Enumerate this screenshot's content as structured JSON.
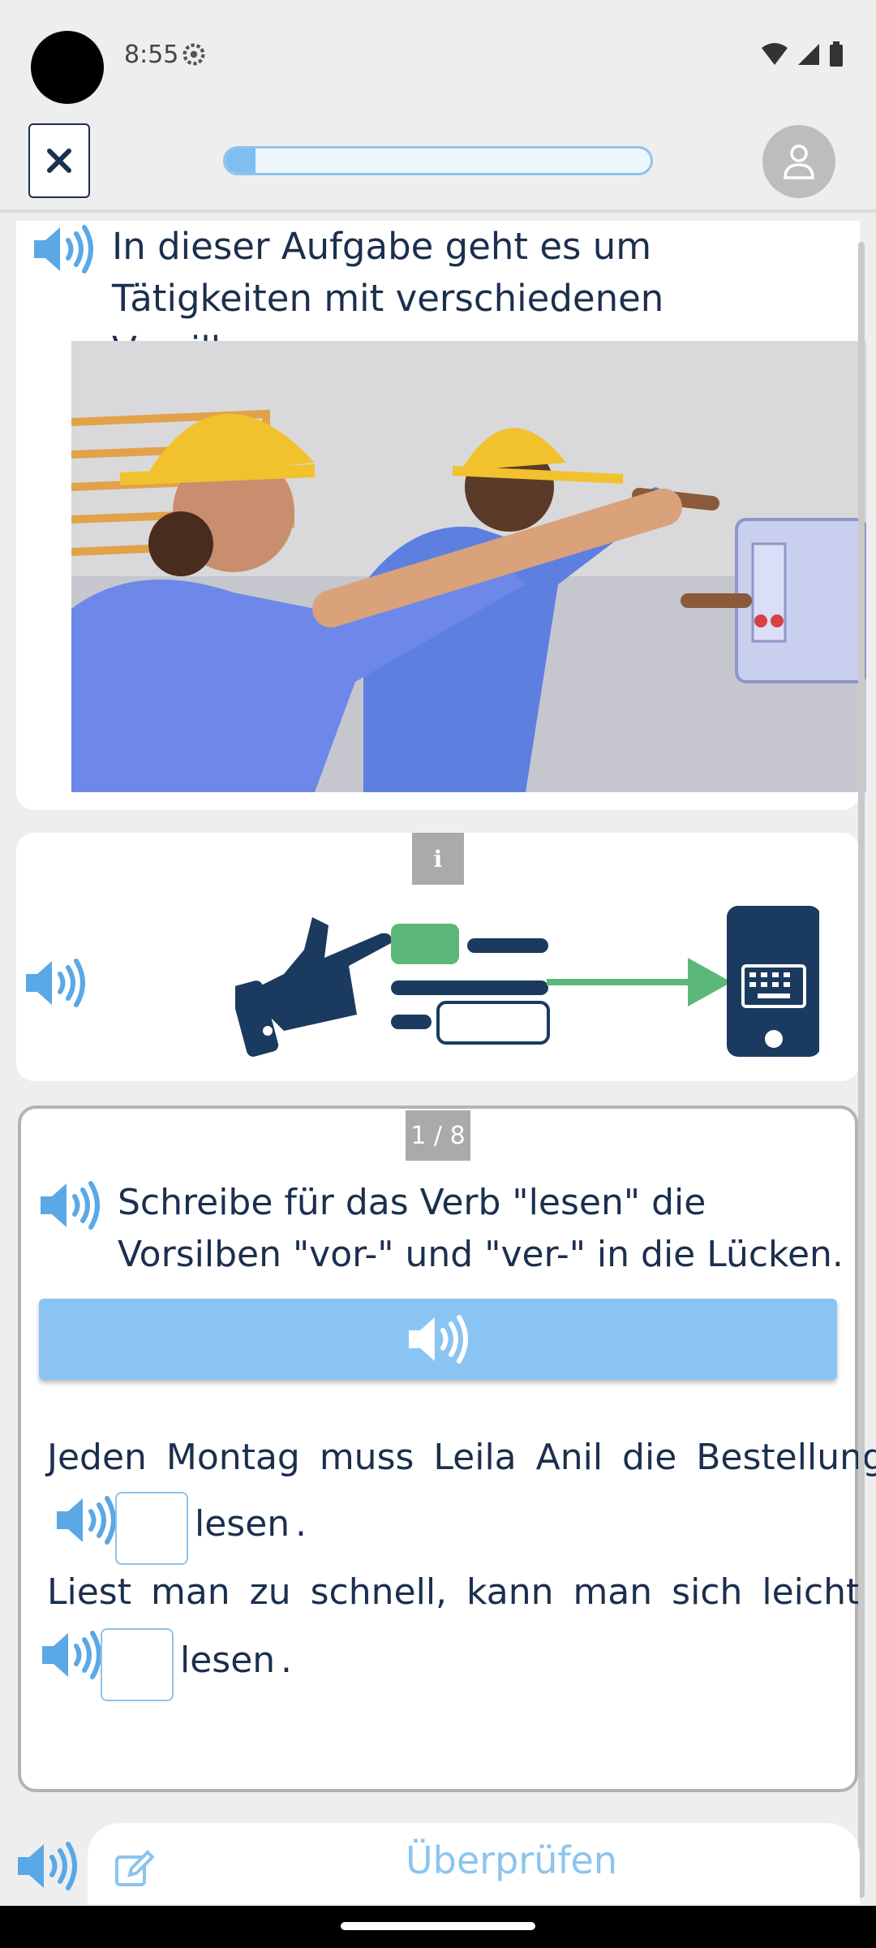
{
  "status_bar": {
    "time": "8:55"
  },
  "progress": {
    "value": 0.07
  },
  "intro": {
    "text": "In dieser Aufgabe geht es um Tätigkeiten mit verschiedenen Vorsilben."
  },
  "info": {
    "badge": "i"
  },
  "task": {
    "page": "1 / 8",
    "instruction": "Schreibe für das Verb \"lesen\" die Vorsilben \"vor-\" und \"ver-\" in die Lücken.",
    "sentences": [
      {
        "text": "Jeden Montag muss Leila Anil die Bestellung",
        "gap_value": "",
        "suffix": "lesen",
        "end": "."
      },
      {
        "text": "Liest man zu schnell, kann man sich leicht",
        "gap_value": "",
        "suffix": "lesen",
        "end": "."
      }
    ]
  },
  "footer": {
    "check_label": "Überprüfen"
  },
  "icons": {
    "close": "close-icon",
    "avatar": "user-icon",
    "speaker": "speaker-icon",
    "settings": "gear-icon",
    "edit": "edit-icon"
  },
  "colors": {
    "primary": "#1b2f4e",
    "accent": "#89c4f2",
    "green": "#5cb87a",
    "badge": "#aaaaaa"
  }
}
